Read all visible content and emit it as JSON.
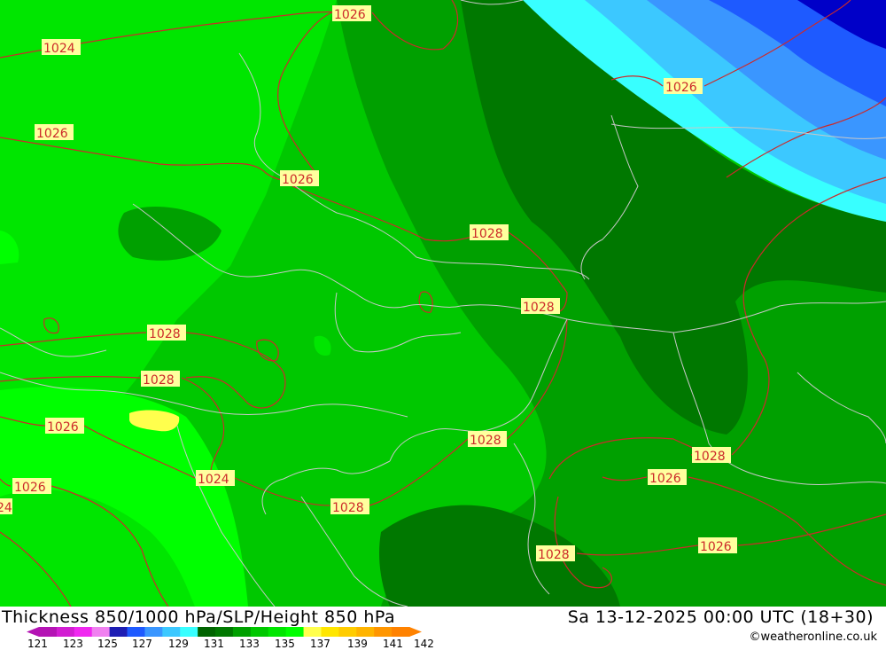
{
  "map": {
    "isobar_labels": [
      "1026",
      "1024",
      "1026",
      "1026",
      "1026",
      "1028",
      "1028",
      "1028",
      "1028",
      "1026",
      "1024",
      "1028",
      "1028",
      "1028",
      "1028",
      "1026",
      "1026",
      "24"
    ],
    "colors": {
      "dark_green": "#007800",
      "mid_green": "#00a000",
      "green": "#00c800",
      "light_green": "#00e600",
      "bright_green": "#00ff00",
      "yellow": "#ffff4d",
      "cyan": "#38ffff",
      "light_blue": "#3cc8ff",
      "blue": "#3a96ff",
      "dark_blue": "#1e5aff",
      "navy": "#0000c8",
      "isobar": "#cc2a2a",
      "border": "#c8c8c8"
    }
  },
  "footer": {
    "title_left": "Thickness 850/1000 hPa/SLP/Height 850 hPa",
    "title_right": "Sa 13-12-2025 00:00 UTC (18+30)",
    "credit": "©weatheronline.co.uk",
    "legend_ticks": [
      "121",
      "123",
      "125",
      "127",
      "129",
      "131",
      "133",
      "135",
      "137",
      "139",
      "141",
      "142"
    ],
    "legend_colors": [
      "#b414b4",
      "#d21ed2",
      "#f028f0",
      "#f080f0",
      "#1e1eb4",
      "#1e5aff",
      "#3a96ff",
      "#3cc8ff",
      "#38ffff",
      "#006400",
      "#007800",
      "#00a000",
      "#00c800",
      "#00e600",
      "#00ff00",
      "#ffff4d",
      "#ffe600",
      "#ffcc00",
      "#ffb400",
      "#ff9600",
      "#ff8200"
    ]
  }
}
